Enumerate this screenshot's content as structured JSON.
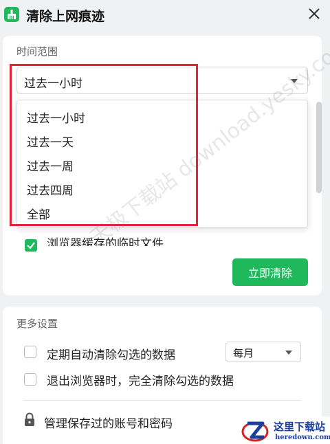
{
  "window": {
    "title": "清除上网痕迹",
    "app_icon": "broom-icon",
    "close_icon": "close-icon"
  },
  "time_range": {
    "label": "时间范围",
    "selected": "过去一小时",
    "options": [
      "过去一小时",
      "过去一天",
      "过去一周",
      "过去四周",
      "全部"
    ]
  },
  "partial_checkbox_label": "浏览器缓存的临时文件",
  "clear_button": "立即清除",
  "more_settings": {
    "label": "更多设置",
    "auto_clear_label": "定期自动清除勾选的数据",
    "frequency": "每月",
    "clear_on_exit_label": "退出浏览器时，完全清除勾选的数据",
    "manage_passwords_label": "管理保存过的账号和密码"
  },
  "watermark": "天极下载站 download.yesky.com",
  "site_logo": {
    "title": "这里下载站",
    "domain": "heredown.com"
  },
  "colors": {
    "accent_green": "#1fb95c",
    "highlight_red": "#e8203a"
  }
}
